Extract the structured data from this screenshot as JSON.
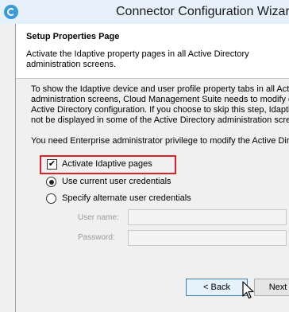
{
  "window": {
    "title": "Connector Configuration Wizard"
  },
  "header": {
    "title": "Setup Properties Page",
    "subtitle": "Activate the Idaptive property pages in all Active Directory administration screens."
  },
  "body": {
    "para1_lines": [
      "To show the Idaptive device and user profile property tabs in all Active",
      "administration screens, Cloud Management Suite needs to modify dis",
      "Active Directory configuration. If you choose to skip this step, Idaptive",
      "not be displayed in some of the Active Directory administration screen"
    ],
    "para2": "You need Enterprise administrator privilege to modify the Active Direc"
  },
  "options": {
    "activate_label": "Activate Idaptive pages",
    "activate_checked": true,
    "use_current_label": "Use current user credentials",
    "use_current_selected": true,
    "specify_alternate_label": "Specify alternate user credentials",
    "specify_alternate_selected": false
  },
  "credentials": {
    "username_label": "User name:",
    "password_label": "Password:"
  },
  "buttons": {
    "back_label": "< Back",
    "next_label": "Next"
  },
  "colors": {
    "highlight": "#d9222a",
    "titlebar": "#e6f0fa",
    "accent": "#3a9ad9"
  }
}
